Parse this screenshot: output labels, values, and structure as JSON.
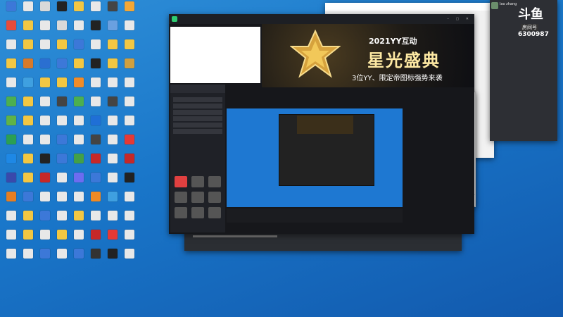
{
  "desktop": {
    "icons": [
      {
        "glyph": "#3c78d8"
      },
      {
        "glyph": "#e8e8e8"
      },
      {
        "glyph": "#d9d9d9"
      },
      {
        "glyph": "#222"
      },
      {
        "glyph": "#f3c742"
      },
      {
        "glyph": "#e8e8e8"
      },
      {
        "glyph": "#444"
      },
      {
        "glyph": "#f4a734"
      },
      {
        "glyph": "#e74c3c"
      },
      {
        "glyph": "#f3c742"
      },
      {
        "glyph": "#e8e8e8"
      },
      {
        "glyph": "#d9d9d9"
      },
      {
        "glyph": "#e8e8e8"
      },
      {
        "glyph": "#222"
      },
      {
        "glyph": "#6aa0e0"
      },
      {
        "glyph": "#e8e8e8"
      },
      {
        "glyph": "#e8e8e8"
      },
      {
        "glyph": "#f3c742"
      },
      {
        "glyph": "#e8e8e8"
      },
      {
        "glyph": "#f3c742"
      },
      {
        "glyph": "#3c78d8"
      },
      {
        "glyph": "#e8e8e8"
      },
      {
        "glyph": "#f3c742"
      },
      {
        "glyph": "#f3c742"
      },
      {
        "glyph": "#f3c742"
      },
      {
        "glyph": "#d77a2a"
      },
      {
        "glyph": "#2a6fd1"
      },
      {
        "glyph": "#3c78d8"
      },
      {
        "glyph": "#f3c742"
      },
      {
        "glyph": "#222"
      },
      {
        "glyph": "#f3c742"
      },
      {
        "glyph": "#d0a040"
      },
      {
        "glyph": "#e8e8e8"
      },
      {
        "glyph": "#3fa0e0"
      },
      {
        "glyph": "#f3c742"
      },
      {
        "glyph": "#f3c742"
      },
      {
        "glyph": "#f28c28"
      },
      {
        "glyph": "#e8e8e8"
      },
      {
        "glyph": "#e8e8e8"
      },
      {
        "glyph": "#e8e8e8"
      },
      {
        "glyph": "#4caf50"
      },
      {
        "glyph": "#f3c742"
      },
      {
        "glyph": "#e8e8e8"
      },
      {
        "glyph": "#444"
      },
      {
        "glyph": "#4caf50"
      },
      {
        "glyph": "#e8e8e8"
      },
      {
        "glyph": "#444"
      },
      {
        "glyph": "#e8e8e8"
      },
      {
        "glyph": "#5fb348"
      },
      {
        "glyph": "#f3c742"
      },
      {
        "glyph": "#e8e8e8"
      },
      {
        "glyph": "#e8e8e8"
      },
      {
        "glyph": "#e8e8e8"
      },
      {
        "glyph": "#1f6fd6"
      },
      {
        "glyph": "#e8e8e8"
      },
      {
        "glyph": "#e8e8e8"
      },
      {
        "glyph": "#2b9f53"
      },
      {
        "glyph": "#e8e8e8"
      },
      {
        "glyph": "#e8e8e8"
      },
      {
        "glyph": "#3c78d8"
      },
      {
        "glyph": "#e8e8e8"
      },
      {
        "glyph": "#444"
      },
      {
        "glyph": "#e8e8e8"
      },
      {
        "glyph": "#e53935"
      },
      {
        "glyph": "#1e88e5"
      },
      {
        "glyph": "#f3c742"
      },
      {
        "glyph": "#222"
      },
      {
        "glyph": "#3c78d8"
      },
      {
        "glyph": "#43a047"
      },
      {
        "glyph": "#c62828"
      },
      {
        "glyph": "#e8e8e8"
      },
      {
        "glyph": "#c62828"
      },
      {
        "glyph": "#3949ab"
      },
      {
        "glyph": "#f3c742"
      },
      {
        "glyph": "#c62828"
      },
      {
        "glyph": "#e8e8e8"
      },
      {
        "glyph": "#6c6cf0"
      },
      {
        "glyph": "#3c78d8"
      },
      {
        "glyph": "#e8e8e8"
      },
      {
        "glyph": "#222"
      },
      {
        "glyph": "#e67e22"
      },
      {
        "glyph": "#3c78d8"
      },
      {
        "glyph": "#e8e8e8"
      },
      {
        "glyph": "#e8e8e8"
      },
      {
        "glyph": "#e8e8e8"
      },
      {
        "glyph": "#f08a24"
      },
      {
        "glyph": "#3fa0e0"
      },
      {
        "glyph": "#e8e8e8"
      },
      {
        "glyph": "#e8e8e8"
      },
      {
        "glyph": "#f3c742"
      },
      {
        "glyph": "#3c78d8"
      },
      {
        "glyph": "#e8e8e8"
      },
      {
        "glyph": "#f3c742"
      },
      {
        "glyph": "#e8e8e8"
      },
      {
        "glyph": "#e8e8e8"
      },
      {
        "glyph": "#e8e8e8"
      },
      {
        "glyph": "#e8e8e8"
      },
      {
        "glyph": "#f3c742"
      },
      {
        "glyph": "#e8e8e8"
      },
      {
        "glyph": "#f3c742"
      },
      {
        "glyph": "#e8e8e8"
      },
      {
        "glyph": "#c62828"
      },
      {
        "glyph": "#e53935"
      },
      {
        "glyph": "#e8e8e8"
      },
      {
        "glyph": "#e8e8e8"
      },
      {
        "glyph": "#e8e8e8"
      },
      {
        "glyph": "#3c78d8"
      },
      {
        "glyph": "#e8e8e8"
      },
      {
        "glyph": "#3c78d8"
      },
      {
        "glyph": "#333"
      },
      {
        "glyph": "#222"
      },
      {
        "glyph": "#e8e8e8"
      }
    ]
  },
  "banner": {
    "year_title": "2021YY互动",
    "main_title": "星光盛典",
    "subtitle": "3位YY、限定帝图标强势来袭"
  },
  "overlay": {
    "user_name": "lao zhang",
    "room_label": "房间号",
    "room_number": "6300987",
    "logo_text": "斗鱼"
  }
}
